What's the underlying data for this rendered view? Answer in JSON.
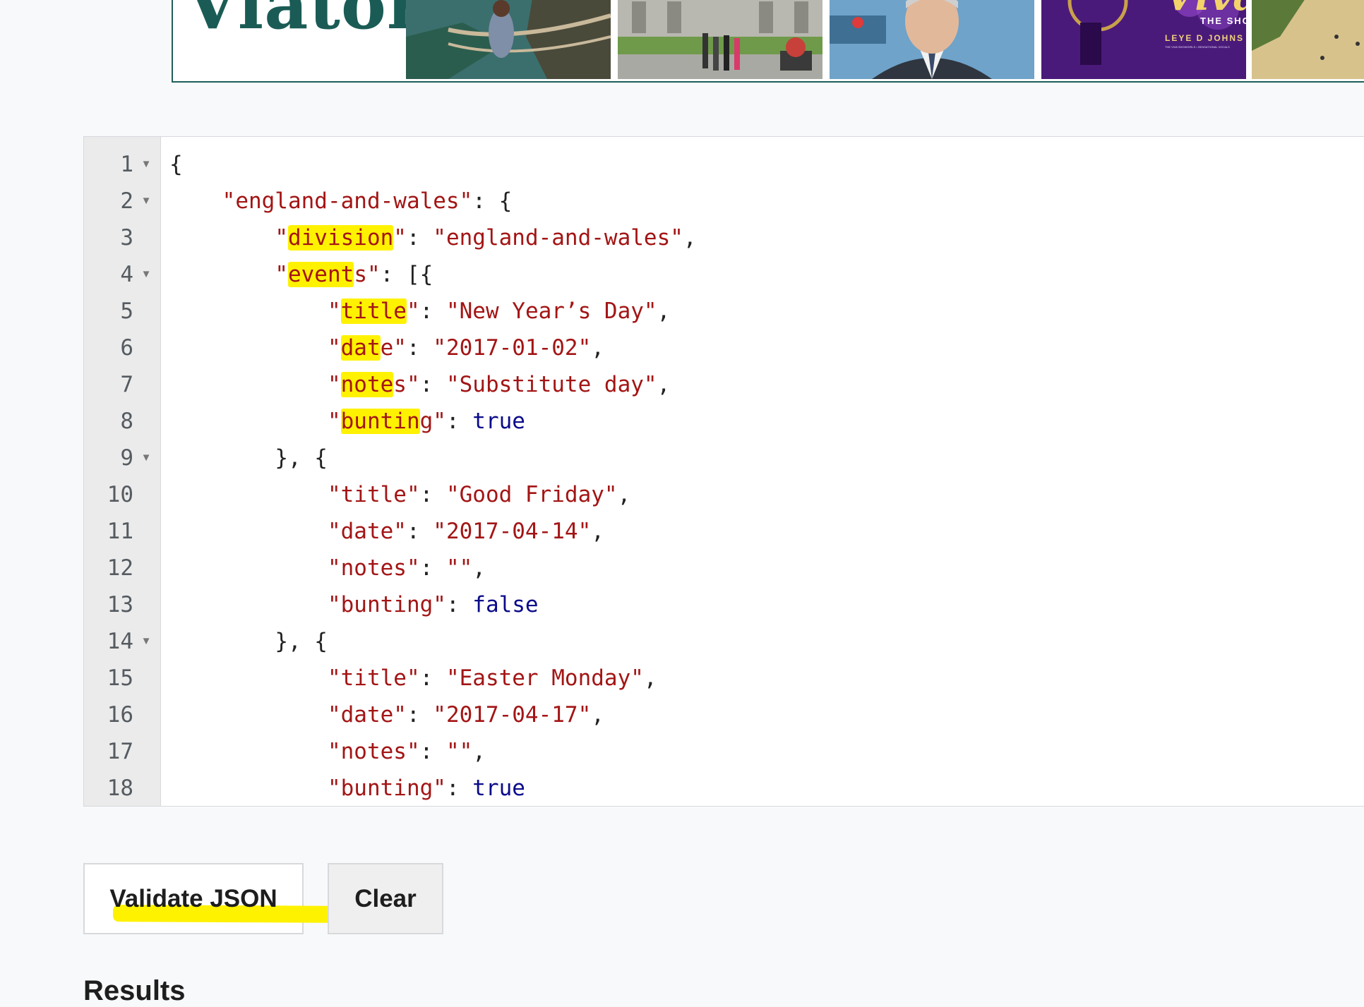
{
  "ad": {
    "logo_text": "Viator",
    "logo_mark": "®",
    "thumbs": [
      {
        "name": "rope-bridge-photo"
      },
      {
        "name": "city-hall-tourists-photo"
      },
      {
        "name": "politician-photo"
      },
      {
        "name": "viva-show-photo",
        "caption_title": "Viva!",
        "caption_show": "THE SHOW",
        "caption_name": "LEYE D JOHNS",
        "caption_small": "THE VIVA SHOWGIRLS • SENSATIONAL VOCALS"
      },
      {
        "name": "beach-photo"
      }
    ],
    "colors": {
      "border": "#1f5f5a",
      "logo": "#1a5c55"
    }
  },
  "editor": {
    "lines": [
      {
        "n": "1",
        "fold": true
      },
      {
        "n": "2",
        "fold": true
      },
      {
        "n": "3",
        "fold": false
      },
      {
        "n": "4",
        "fold": true
      },
      {
        "n": "5",
        "fold": false
      },
      {
        "n": "6",
        "fold": false
      },
      {
        "n": "7",
        "fold": false
      },
      {
        "n": "8",
        "fold": false
      },
      {
        "n": "9",
        "fold": true
      },
      {
        "n": "10",
        "fold": false
      },
      {
        "n": "11",
        "fold": false
      },
      {
        "n": "12",
        "fold": false
      },
      {
        "n": "13",
        "fold": false
      },
      {
        "n": "14",
        "fold": true
      },
      {
        "n": "15",
        "fold": false
      },
      {
        "n": "16",
        "fold": false
      },
      {
        "n": "17",
        "fold": false
      },
      {
        "n": "18",
        "fold": false
      }
    ],
    "code": {
      "l1": "{",
      "l2_key": "\"england-and-wales\"",
      "l2_rest": ": {",
      "l3_key_q1": "\"",
      "l3_key_hl": "division",
      "l3_key_q2": "\"",
      "l3_sep": ": ",
      "l3_val": "\"england-and-wales\"",
      "l3_end": ",",
      "l4_key_q1": "\"",
      "l4_key_hl": "event",
      "l4_key_rest": "s\"",
      "l4_rest": ": [{",
      "l5_key_q1": "\"",
      "l5_key_hl": "title",
      "l5_key_q2": "\"",
      "l5_sep": ": ",
      "l5_val": "\"New Year’s Day\"",
      "l5_end": ",",
      "l6_key_q1": "\"",
      "l6_key_hl": "dat",
      "l6_key_rest": "e\"",
      "l6_sep": ": ",
      "l6_val": "\"2017-01-02\"",
      "l6_end": ",",
      "l7_key_q1": "\"",
      "l7_key_hl": "note",
      "l7_key_rest": "s\"",
      "l7_sep": ": ",
      "l7_val": "\"Substitute day\"",
      "l7_end": ",",
      "l8_key_q1": "\"",
      "l8_key_hl": "buntin",
      "l8_key_rest": "g\"",
      "l8_sep": ": ",
      "l8_val": "true",
      "l9": "}, {",
      "l10_key": "\"title\"",
      "l10_sep": ": ",
      "l10_val": "\"Good Friday\"",
      "l10_end": ",",
      "l11_key": "\"date\"",
      "l11_sep": ": ",
      "l11_val": "\"2017-04-14\"",
      "l11_end": ",",
      "l12_key": "\"notes\"",
      "l12_sep": ": ",
      "l12_val": "\"\"",
      "l12_end": ",",
      "l13_key": "\"bunting\"",
      "l13_sep": ": ",
      "l13_val": "false",
      "l14": "}, {",
      "l15_key": "\"title\"",
      "l15_sep": ": ",
      "l15_val": "\"Easter Monday\"",
      "l15_end": ",",
      "l16_key": "\"date\"",
      "l16_sep": ": ",
      "l16_val": "\"2017-04-17\"",
      "l16_end": ",",
      "l17_key": "\"notes\"",
      "l17_sep": ": ",
      "l17_val": "\"\"",
      "l17_end": ",",
      "l18_key": "\"bunting\"",
      "l18_sep": ": ",
      "l18_val": "true"
    },
    "colors": {
      "string": "#a31515",
      "boolean": "#0b0b8a",
      "highlight": "#fff200"
    }
  },
  "buttons": {
    "validate_label": "Validate JSON",
    "clear_label": "Clear"
  },
  "results": {
    "heading": "Results"
  }
}
